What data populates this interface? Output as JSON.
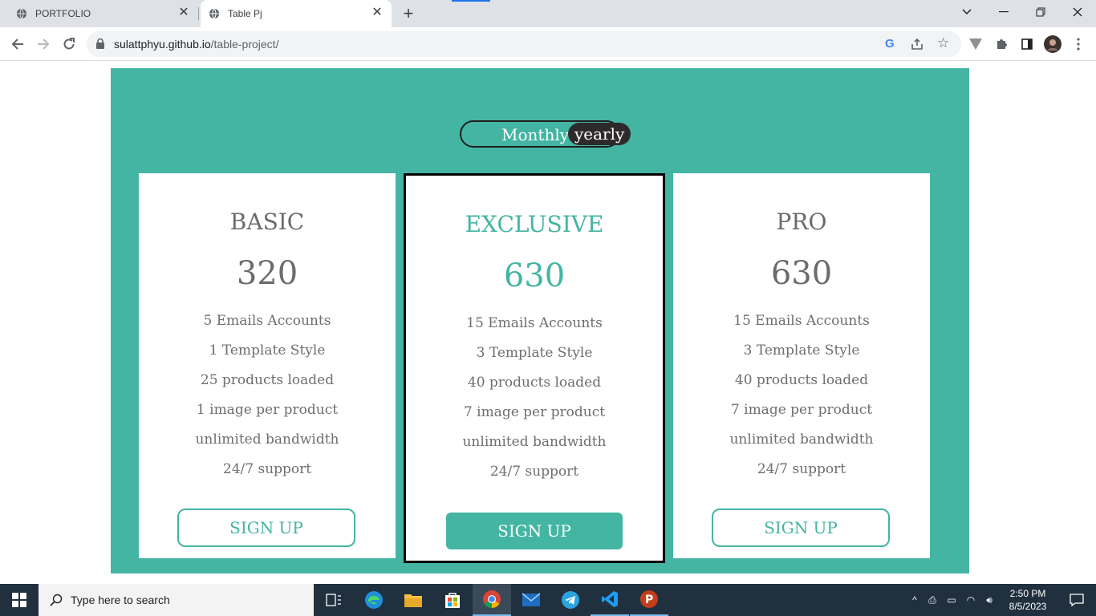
{
  "browser": {
    "tabs": [
      {
        "title": "PORTFOLIO",
        "active": false
      },
      {
        "title": "Table Pj",
        "active": true
      }
    ],
    "new_tab_label": "+",
    "url_host": "sulattphyu.github.io",
    "url_path": "/table-project/"
  },
  "page": {
    "toggle": {
      "monthly": "Monthly",
      "yearly": "yearly"
    },
    "plans": [
      {
        "name": "BASIC",
        "price": "320",
        "features": [
          "5 Emails Accounts",
          "1 Template Style",
          "25 products loaded",
          "1 image per product",
          "unlimited bandwidth",
          "24/7 support"
        ],
        "button": "SIGN UP"
      },
      {
        "name": "EXCLUSIVE",
        "price": "630",
        "features": [
          "15 Emails Accounts",
          "3 Template Style",
          "40 products loaded",
          "7 image per product",
          "unlimited bandwidth",
          "24/7 support"
        ],
        "button": "SIGN UP"
      },
      {
        "name": "PRO",
        "price": "630",
        "features": [
          "15 Emails Accounts",
          "3 Template Style",
          "40 products loaded",
          "7 image per product",
          "unlimited bandwidth",
          "24/7 support"
        ],
        "button": "SIGN UP"
      }
    ],
    "colors": {
      "accent": "#43b5a2",
      "toggle_active": "#2e2a2b"
    }
  },
  "taskbar": {
    "search_placeholder": "Type here to search",
    "time": "2:50 PM",
    "date": "8/5/2023"
  }
}
